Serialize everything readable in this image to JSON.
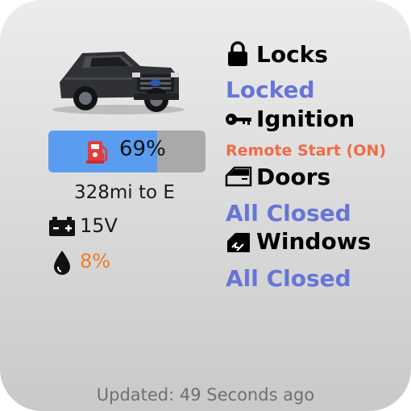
{
  "vehicle": {
    "fuel_level": 0.69,
    "fuel_text": "69%",
    "range": "328mi to E",
    "battery": "15V",
    "oil": "8%"
  },
  "status": {
    "locks": {
      "title": "Locks",
      "value": "Locked"
    },
    "ignition": {
      "title": "Ignition",
      "value": "Remote Start (ON)"
    },
    "doors": {
      "title": "Doors",
      "value": "All Closed"
    },
    "windows": {
      "title": "Windows",
      "value": "All Closed"
    }
  },
  "footer": {
    "updated": "Updated: 49 Seconds ago"
  },
  "colors": {
    "fuel_fill": "#5a9cf0",
    "value_text": "#6675d6",
    "remote_start": "#f06b45",
    "oil_text": "#ee7a2c"
  },
  "icons": [
    "lock-icon",
    "key-icon",
    "door-icon",
    "window-icon",
    "fuel-pump-icon",
    "battery-icon",
    "oil-drop-icon",
    "truck-image"
  ]
}
